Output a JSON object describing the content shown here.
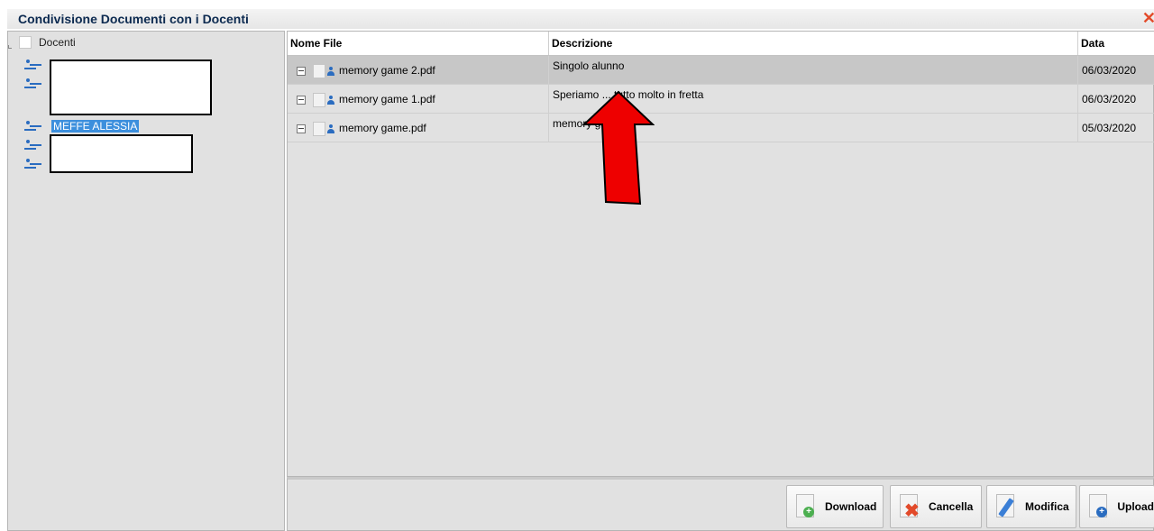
{
  "window": {
    "title": "Condivisione Documenti con i Docenti",
    "close_glyph": "✕"
  },
  "tree": {
    "root_label": "Docenti",
    "selected_teacher": "MEFFE ALESSIA"
  },
  "grid": {
    "columns": [
      "Nome File",
      "Descrizione",
      "Data"
    ],
    "rows": [
      {
        "file": "memory game 2.pdf",
        "description": "Singolo alunno",
        "date": "06/03/2020"
      },
      {
        "file": "memory game 1.pdf",
        "description": "Speriamo ... tutto molto in fretta",
        "date": "06/03/2020"
      },
      {
        "file": "memory game.pdf",
        "description": "memory ga...",
        "date": "05/03/2020"
      }
    ]
  },
  "toolbar": {
    "download": "Download",
    "cancella": "Cancella",
    "modifica": "Modifica",
    "upload": "Upload"
  },
  "colors": {
    "accent_blue": "#3c8fdd",
    "close_red": "#e34b2b",
    "arrow_red": "#ee0000"
  }
}
